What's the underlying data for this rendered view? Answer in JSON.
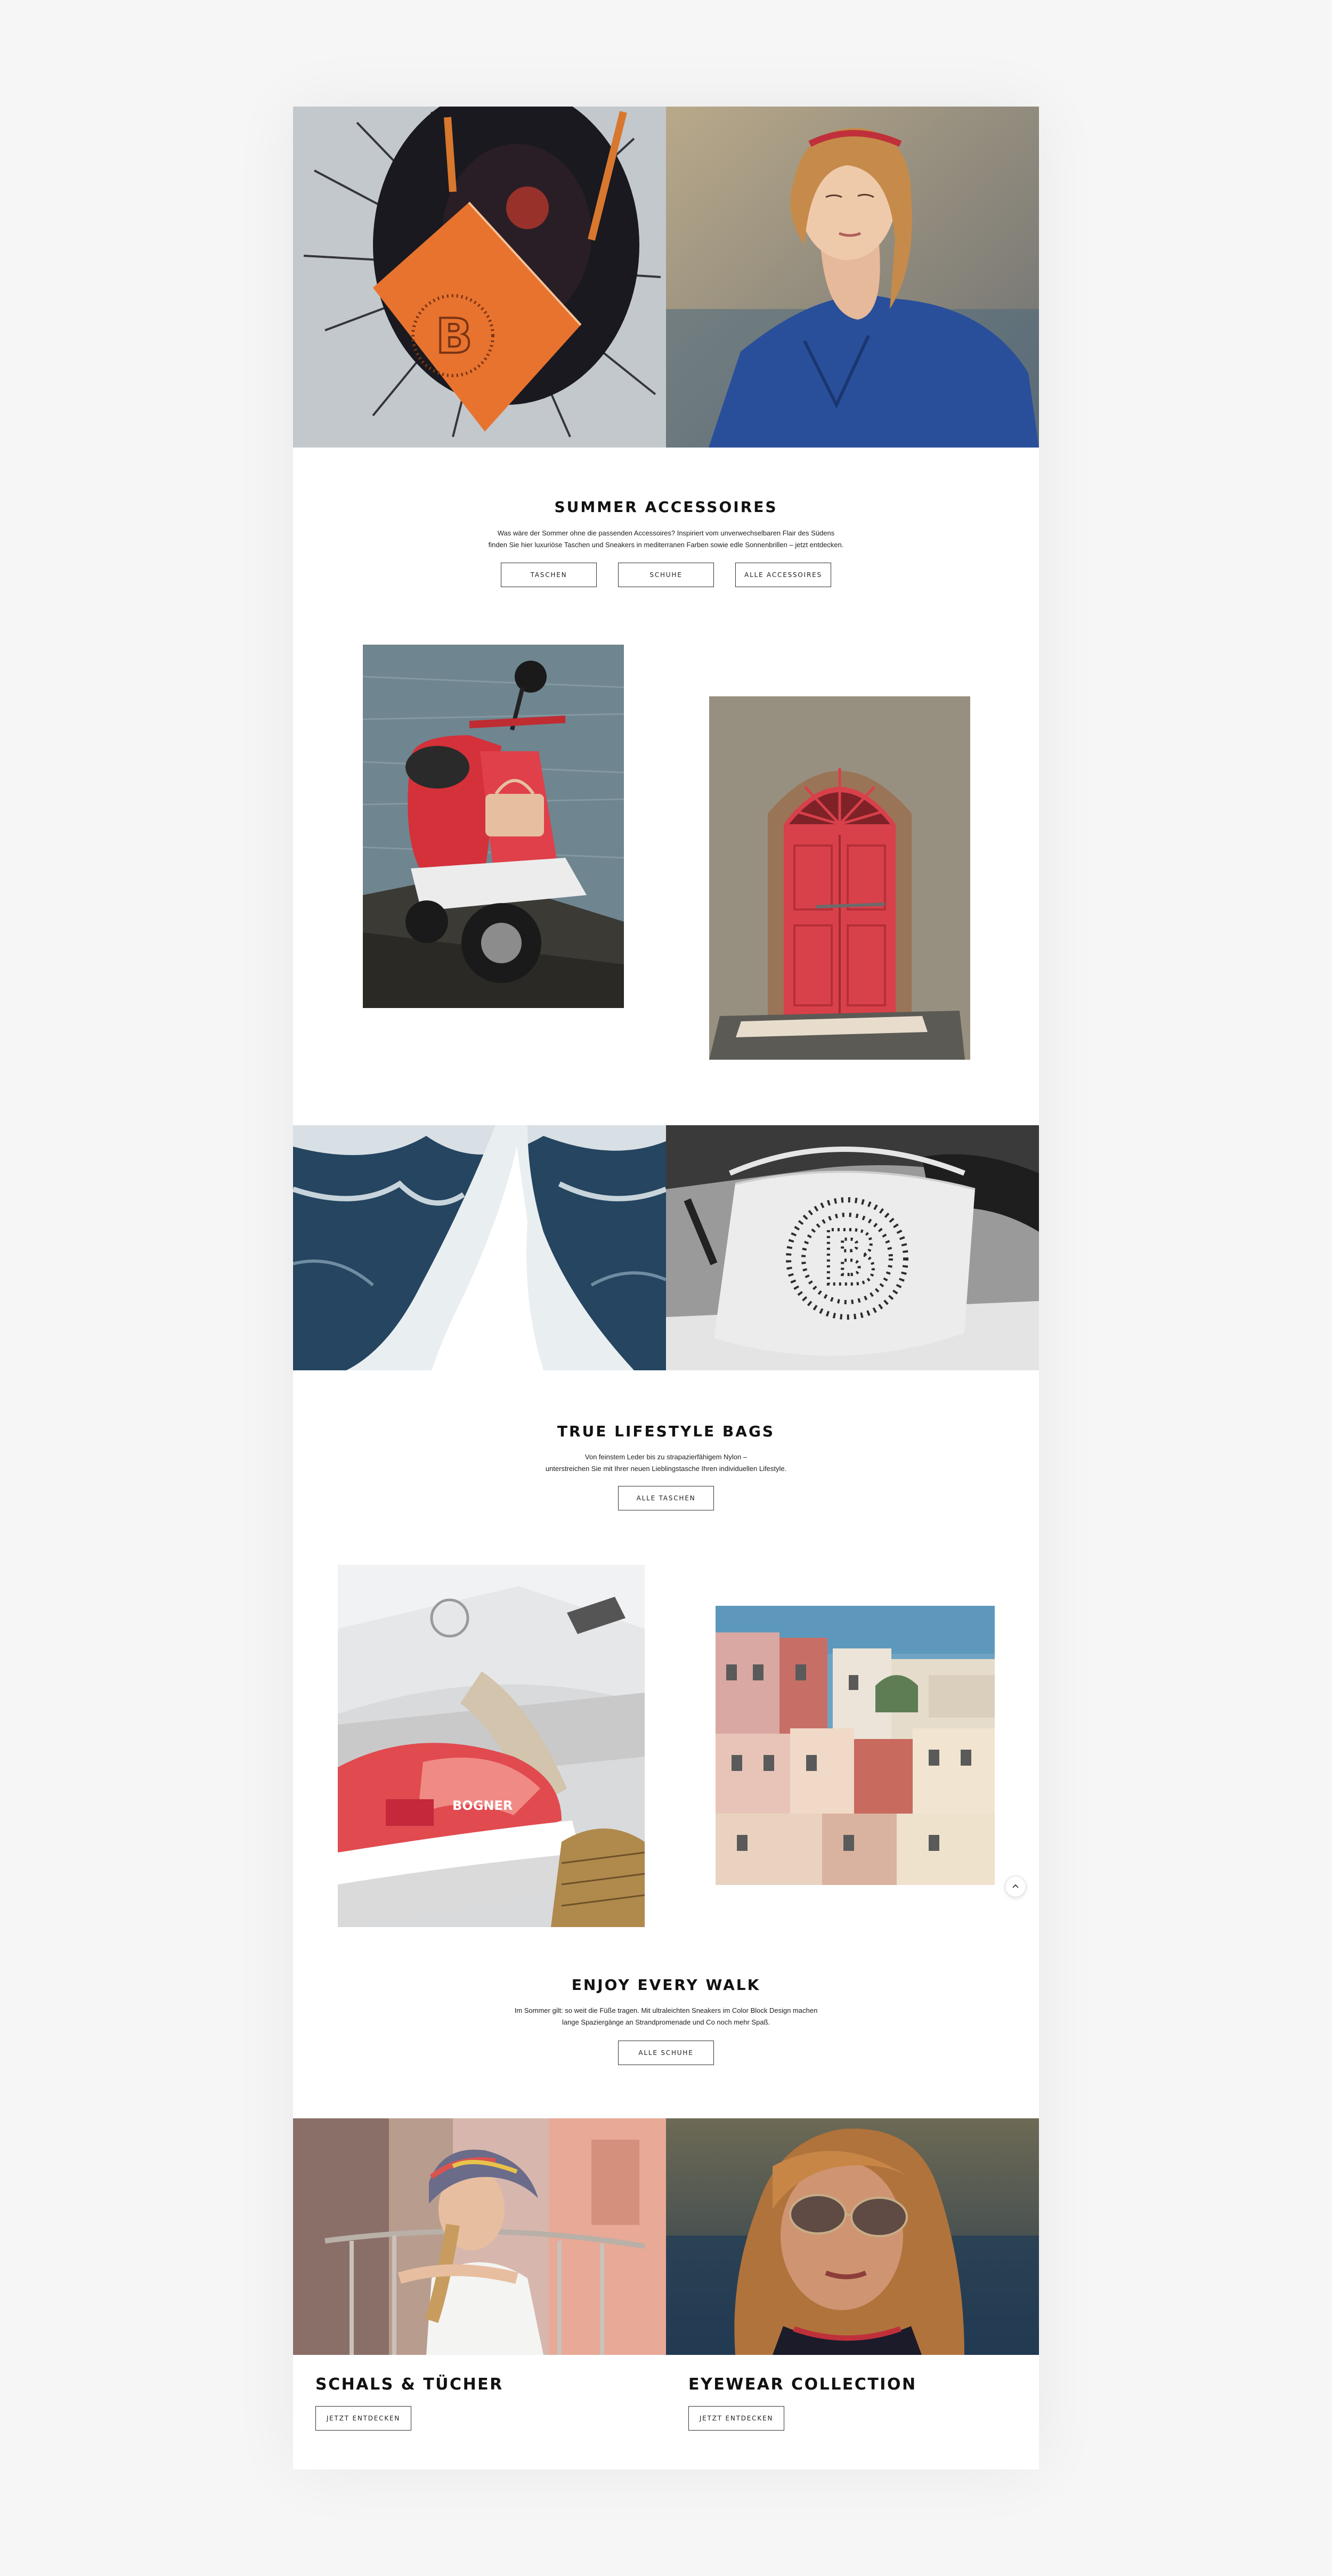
{
  "summer": {
    "title": "SUMMER ACCESSOIRES",
    "text_line1": "Was wäre der Sommer ohne die passenden Accessoires? Inspiriert vom unverwechselbaren Flair des Südens",
    "text_line2": "finden Sie hier luxuriöse Taschen und Sneakers in mediterranen Farben sowie edle Sonnenbrillen – jetzt entdecken.",
    "buttons": [
      "TASCHEN",
      "SCHUHE",
      "ALLE ACCESSOIRES"
    ]
  },
  "bags": {
    "title": "TRUE LIFESTYLE BAGS",
    "text_line1": "Von feinstem Leder bis zu strapazierfähigem Nylon –",
    "text_line2": "unterstreichen Sie mit Ihrer neuen Lieblingstasche Ihren individuellen Lifestyle.",
    "button": "ALLE TASCHEN"
  },
  "walk": {
    "title": "ENJOY EVERY WALK",
    "text_line1": "Im Sommer gilt: so weit die Füße tragen. Mit ultraleichten Sneakers im Color Block Design machen",
    "text_line2": "lange Spaziergänge an Strandpromenade und Co noch mehr Spaß.",
    "button": "ALLE SCHUHE",
    "sneaker_brand": "BOGNER"
  },
  "scarves": {
    "title": "SCHALS & TÜCHER",
    "button": "JETZT ENTDECKEN"
  },
  "eyewear": {
    "title": "EYEWEAR COLLECTION",
    "button": "JETZT ENTDECKEN"
  },
  "scroll_top_icon": "chevron-up-icon",
  "colors": {
    "page_bg": "#f6f6f6",
    "content_bg": "#ffffff",
    "button_border": "#333333",
    "vespa_red": "#d4313a",
    "bag_orange": "#e8732e",
    "sea_blue": "#2b4d68"
  }
}
